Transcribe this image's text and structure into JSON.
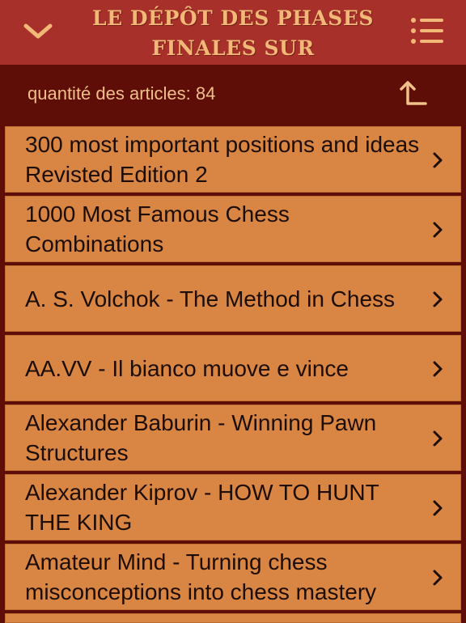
{
  "header": {
    "title": "Le dépôt des phases finales sur internet",
    "back_icon": "chevron-down-icon",
    "menu_icon": "list-menu-icon"
  },
  "subheader": {
    "count_text": "quantité des articles: 84",
    "up_icon": "level-up-icon"
  },
  "items": [
    {
      "title": "300 most important positions and ideas Revisted Edition 2"
    },
    {
      "title": "1000 Most Famous Chess Combinations"
    },
    {
      "title": "A. S. Volchok - The Method in Chess"
    },
    {
      "title": "AA.VV - Il bianco muove e vince"
    },
    {
      "title": "Alexander Baburin - Winning Pawn Structures"
    },
    {
      "title": "Alexander Kiprov - HOW TO HUNT THE KING"
    },
    {
      "title": "Amateur Mind  - Turning chess misconceptions into chess mastery"
    }
  ],
  "colors": {
    "topbar": "#a7312a",
    "subbar": "#5e0d07",
    "row": "#d98544",
    "title_text": "#f1b877",
    "row_text": "#1c0d05"
  }
}
